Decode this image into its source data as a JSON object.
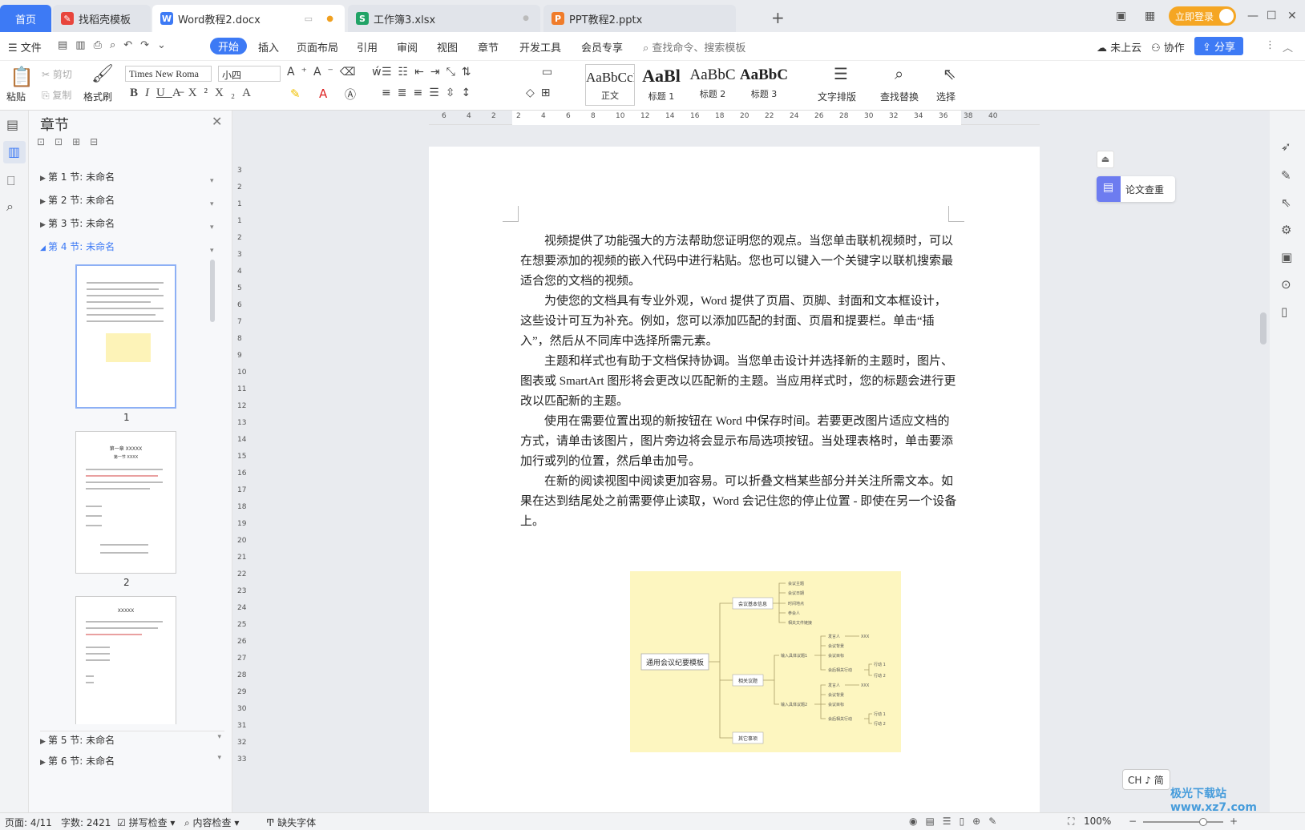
{
  "tabs": {
    "home": "首页",
    "items": [
      {
        "label": "找稻壳模板",
        "icon": "daoke-icon",
        "color": "#e8453c"
      },
      {
        "label": "Word教程2.docx",
        "icon": "word-icon",
        "color": "#3d7af5"
      },
      {
        "label": "工作簿3.xlsx",
        "icon": "excel-icon",
        "color": "#21a366"
      },
      {
        "label": "PPT教程2.pptx",
        "icon": "ppt-icon",
        "color": "#f07c2a"
      }
    ],
    "add": "+",
    "login": "立即登录"
  },
  "menu": {
    "file": "文件",
    "items": [
      "开始",
      "插入",
      "页面布局",
      "引用",
      "审阅",
      "视图",
      "章节",
      "开发工具",
      "会员专享"
    ],
    "search": "查找命令、搜索模板",
    "cloud": "未上云",
    "collab": "协作",
    "share": "分享"
  },
  "toolbar": {
    "paste": "粘贴",
    "cut": "剪切",
    "copy": "复制",
    "format_painter": "格式刷",
    "font": "Times New Roma",
    "size": "小四",
    "styles": [
      {
        "sample": "AaBbCcI",
        "name": "正文"
      },
      {
        "sample": "AaBl",
        "name": "标题 1"
      },
      {
        "sample": "AaBbC",
        "name": "标题 2"
      },
      {
        "sample": "AaBbC",
        "name": "标题 3"
      }
    ],
    "text_layout": "文字排版",
    "find_replace": "查找替换",
    "select": "选择"
  },
  "chapter": {
    "title": "章节",
    "sections": [
      "第 1 节: 未命名",
      "第 2 节: 未命名",
      "第 3 节: 未命名",
      "第 4 节: 未命名",
      "第 5 节: 未命名",
      "第 6 节: 未命名"
    ],
    "page_nums": [
      "1",
      "2"
    ],
    "thumb2_title": "第一章 XXXXX",
    "thumb2_sub": "第一节 XXXX",
    "thumb3_title": "XXXXX"
  },
  "document": {
    "paragraphs": [
      "视频提供了功能强大的方法帮助您证明您的观点。当您单击联机视频时，可以在想要添加的视频的嵌入代码中进行粘贴。您也可以键入一个关键字以联机搜索最适合您的文档的视频。",
      "为使您的文档具有专业外观，Word 提供了页眉、页脚、封面和文本框设计，这些设计可互为补充。例如，您可以添加匹配的封面、页眉和提要栏。单击“插入”，然后从不同库中选择所需元素。",
      "主题和样式也有助于文档保持协调。当您单击设计并选择新的主题时，图片、图表或 SmartArt 图形将会更改以匹配新的主题。当应用样式时，您的标题会进行更改以匹配新的主题。",
      "使用在需要位置出现的新按钮在 Word 中保存时间。若要更改图片适应文档的方式，请单击该图片，图片旁边将会显示布局选项按钮。当处理表格时，单击要添加行或列的位置，然后单击加号。",
      "在新的阅读视图中阅读更加容易。可以折叠文档某些部分并关注所需文本。如果在达到结尾处之前需要停止读取，Word 会记住您的停止位置 - 即使在另一个设备上。"
    ],
    "mindmap": {
      "root": "通用会议纪要模板",
      "b1": "会议基本信息",
      "b1_items": [
        "会议主题",
        "会议日期",
        "时间地点",
        "参会人",
        "相关文件链接"
      ],
      "b2": "相关议题",
      "sub1": "输入具体议题1",
      "sub2": "输入具体议题2",
      "leaf": [
        "发言人",
        "会议背景",
        "会议目标",
        "会后相关行动"
      ],
      "xxx": "XXX",
      "act": [
        "行动 1",
        "行动 2"
      ],
      "b3": "其它事项"
    }
  },
  "float": {
    "paper_check": "论文查重",
    "ime": "CH ♪ 简"
  },
  "status": {
    "page": "页面: 4/11",
    "words": "字数: 2421",
    "spell": "拼写检查",
    "content_check": "内容检查",
    "missing_font": "缺失字体",
    "zoom": "100%"
  },
  "ruler_h": [
    "6",
    "4",
    "2",
    "2",
    "4",
    "6",
    "8",
    "10",
    "12",
    "14",
    "16",
    "18",
    "20",
    "22",
    "24",
    "26",
    "28",
    "30",
    "32",
    "34",
    "36",
    "38",
    "40"
  ],
  "ruler_v": [
    "3",
    "2",
    "1",
    "1",
    "2",
    "3",
    "4",
    "5",
    "6",
    "7",
    "8",
    "9",
    "10",
    "11",
    "12",
    "13",
    "14",
    "15",
    "16",
    "17",
    "18",
    "19",
    "20",
    "21",
    "22",
    "23",
    "24",
    "25",
    "26",
    "27",
    "28",
    "29",
    "30",
    "31",
    "32",
    "33"
  ],
  "watermark": "极光下载站 www.xz7.com"
}
